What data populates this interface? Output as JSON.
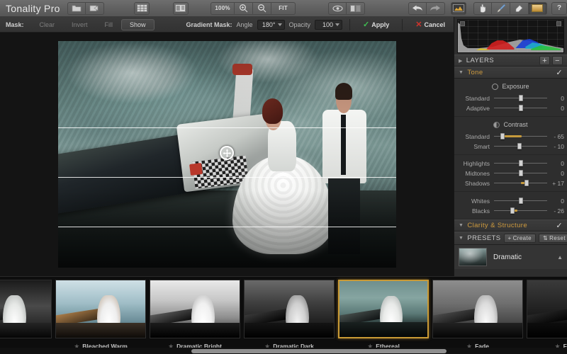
{
  "app": {
    "title": "Tonality Pro"
  },
  "toolbar": {
    "open_icon": "folder-open-icon",
    "share_icon": "share-export-icon",
    "grid_icon": "grid-view-icon",
    "split_icon": "split-view-icon",
    "zoom_value": "100%",
    "zoom_in_icon": "zoom-in-icon",
    "zoom_out_icon": "zoom-out-icon",
    "fit_label": "FIT",
    "preview_icon": "eye-preview-icon",
    "compare_icon": "compare-icon",
    "undo_icon": "undo-arrow-icon",
    "redo_icon": "redo-arrow-icon",
    "histogram_icon": "histogram-icon",
    "hand_icon": "hand-tool-icon",
    "brush_icon": "brush-tool-icon",
    "eraser_icon": "eraser-tool-icon",
    "gradient_icon": "gradient-tool-icon",
    "help_icon": "help-question-icon"
  },
  "maskbar": {
    "label": "Mask:",
    "buttons": [
      {
        "label": "Clear",
        "active": false
      },
      {
        "label": "Invert",
        "active": false
      },
      {
        "label": "Fill",
        "active": false
      },
      {
        "label": "Show",
        "active": true
      }
    ],
    "gradient_mask_label": "Gradient Mask:",
    "angle_label": "Angle",
    "angle_value": "180°",
    "opacity_label": "Opacity",
    "opacity_value": "100",
    "apply_label": "Apply",
    "cancel_label": "Cancel"
  },
  "panel": {
    "layers": {
      "label": "LAYERS",
      "add_icon": "plus-icon",
      "remove_icon": "minus-icon"
    },
    "tone": {
      "label": "Tone",
      "enabled_icon": "checkmark-icon",
      "exposure_group": "Exposure",
      "contrast_group": "Contrast",
      "sliders": [
        {
          "name": "Standard",
          "value": "0",
          "pct": 50,
          "fill": 0
        },
        {
          "name": "Adaptive",
          "value": "0",
          "pct": 50,
          "fill": 0
        },
        {
          "name": "Standard",
          "value": "- 65",
          "pct": 12,
          "fill": 38
        },
        {
          "name": "Smart",
          "value": "- 10",
          "pct": 44,
          "fill": 0
        },
        {
          "name": "Highlights",
          "value": "0",
          "pct": 50,
          "fill": 0
        },
        {
          "name": "Midtones",
          "value": "0",
          "pct": 50,
          "fill": 0
        },
        {
          "name": "Shadows",
          "value": "+ 17",
          "pct": 59,
          "fill": 0
        },
        {
          "name": "Whites",
          "value": "0",
          "pct": 50,
          "fill": 0
        },
        {
          "name": "Blacks",
          "value": "- 26",
          "pct": 32,
          "fill": 10
        }
      ]
    },
    "clarity": {
      "label": "Clarity & Structure",
      "enabled_icon": "checkmark-icon"
    },
    "presets": {
      "label": "PRESETS",
      "create_label": "Create",
      "reset_label": "Reset",
      "selected_name": "Dramatic",
      "collapse_icon": "caret-up-icon"
    }
  },
  "filmstrip": {
    "items": [
      {
        "label": "",
        "selected": false
      },
      {
        "label": "Bleached Warm",
        "selected": false
      },
      {
        "label": "Dramatic Bright",
        "selected": false
      },
      {
        "label": "Dramatic Dark",
        "selected": false
      },
      {
        "label": "Ethereal",
        "selected": true
      },
      {
        "label": "Fade",
        "selected": false
      },
      {
        "label": "Film Noir",
        "selected": false
      }
    ],
    "star_icon": "star-icon"
  },
  "canvas": {
    "move_handle_icon": "move-crosshair-icon",
    "gradient_lines": [
      38,
      60,
      82
    ]
  },
  "colors": {
    "accent": "#c69a3c",
    "apply_green": "#3fbf52",
    "cancel_red": "#d0342c",
    "panel_bg": "#2e2e2e"
  }
}
